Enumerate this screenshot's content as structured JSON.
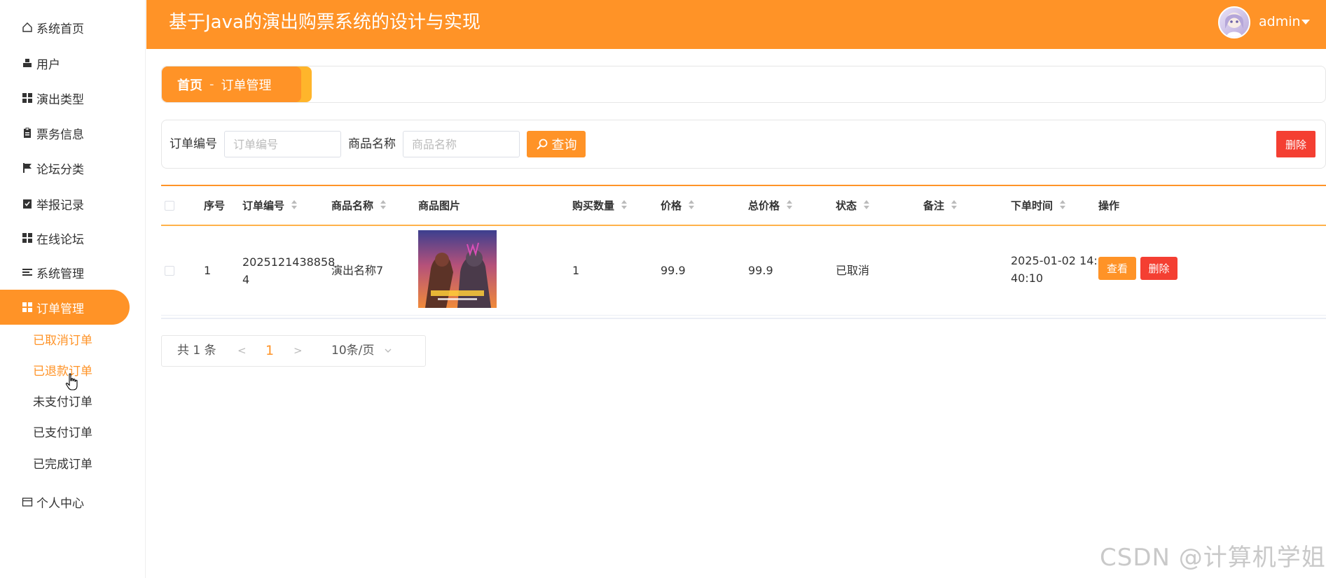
{
  "header": {
    "title": "基于Java的演出购票系统的设计与实现",
    "username": "admin"
  },
  "sidebar": {
    "items": [
      {
        "label": "系统首页",
        "icon": "home-icon"
      },
      {
        "label": "用户",
        "icon": "user-icon"
      },
      {
        "label": "演出类型",
        "icon": "grid-icon"
      },
      {
        "label": "票务信息",
        "icon": "clipboard-icon"
      },
      {
        "label": "论坛分类",
        "icon": "flag-icon"
      },
      {
        "label": "举报记录",
        "icon": "checklist-icon"
      },
      {
        "label": "在线论坛",
        "icon": "grid-icon"
      },
      {
        "label": "系统管理",
        "icon": "list-icon"
      },
      {
        "label": "订单管理",
        "icon": "grid-icon"
      },
      {
        "label": "个人中心",
        "icon": "wallet-icon"
      }
    ],
    "sub_items": [
      {
        "label": "已取消订单"
      },
      {
        "label": "已退款订单"
      },
      {
        "label": "未支付订单"
      },
      {
        "label": "已支付订单"
      },
      {
        "label": "已完成订单"
      }
    ]
  },
  "breadcrumb": {
    "home": "首页",
    "separator": "-",
    "current": "订单管理"
  },
  "search": {
    "order_no_label": "订单编号",
    "order_no_placeholder": "订单编号",
    "product_name_label": "商品名称",
    "product_name_placeholder": "商品名称",
    "query_label": "查询",
    "delete_label": "删除"
  },
  "table": {
    "columns": [
      "序号",
      "订单编号",
      "商品名称",
      "商品图片",
      "购买数量",
      "价格",
      "总价格",
      "状态",
      "备注",
      "下单时间",
      "操作"
    ],
    "rows": [
      {
        "index": "1",
        "order_no_line1": "2025121438858",
        "order_no_line2": "4",
        "product_name": "演出名称7",
        "quantity": "1",
        "price": "99.9",
        "total": "99.9",
        "status": "已取消",
        "remark": "",
        "time_line1": "2025-01-02 14:",
        "time_line2": "40:10",
        "view_label": "查看",
        "delete_label": "删除"
      }
    ]
  },
  "pagination": {
    "total": "共 1 条",
    "prev": "<",
    "current_page": "1",
    "next": ">",
    "page_size": "10条/页"
  },
  "watermark": "CSDN @计算机学姐",
  "colors": {
    "accent": "#ff9327",
    "danger": "#f43f32"
  }
}
